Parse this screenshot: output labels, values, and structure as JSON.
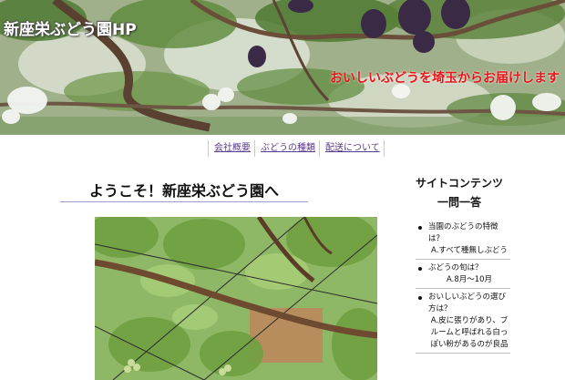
{
  "header": {
    "title": "新座栄ぶどう園HP",
    "tagline": "おいしいぶどうを埼玉からお届けします"
  },
  "nav": {
    "items": [
      {
        "label": "会社概要"
      },
      {
        "label": "ぶどうの種類"
      },
      {
        "label": "配送について"
      }
    ]
  },
  "main": {
    "heading": "ようこそ！新座栄ぶどう園へ"
  },
  "sidebar": {
    "title": "サイトコンテンツ",
    "subtitle": "一問一答",
    "faq": [
      {
        "q": "当園のぶどうの特徴は？",
        "a": "A.すべて種無しぶどう"
      },
      {
        "q": "ぶどうの旬は？",
        "a": "A.8月～10月"
      },
      {
        "q": "おいしいぶどうの選び方は？",
        "a": "A.皮に張りがあり、ブルームと呼ばれる白っぽい粉があるのが良品"
      }
    ]
  },
  "colors": {
    "tagline": "#e8141a",
    "nav_link": "#5b3b8c"
  }
}
